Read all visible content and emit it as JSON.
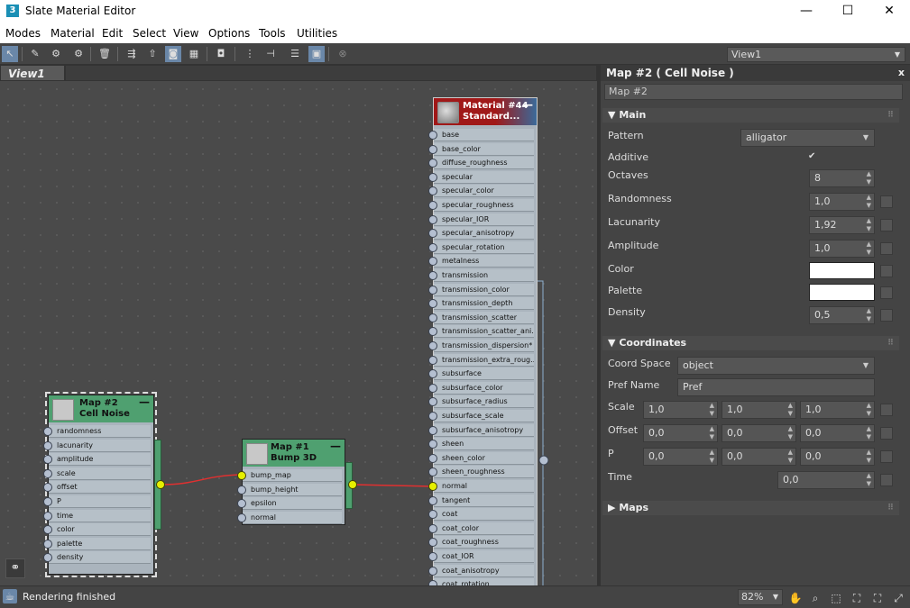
{
  "window": {
    "title": "Slate Material Editor",
    "app_icon": "3",
    "minimize": "—",
    "maximize": "☐",
    "close": "✕"
  },
  "menu": [
    "Modes",
    "Material",
    "Edit",
    "Select",
    "View",
    "Options",
    "Tools",
    "Utilities"
  ],
  "toolbar": {
    "view_select": "View1",
    "icons": [
      "select-arrow",
      "eyedropper",
      "pick-material",
      "put-to-scene",
      "delete",
      "move-children",
      "layout",
      "show-map-viewport",
      "background",
      "unique",
      "layout-all",
      "layout-children",
      "hide-unused-slots",
      "material-to-view",
      "navigator"
    ]
  },
  "view": {
    "tab_label": "View1"
  },
  "nodes": {
    "cell_noise": {
      "title_line1": "Map #2",
      "title_line2": "Cell Noise",
      "min": "—",
      "slots": [
        "randomness",
        "lacunarity",
        "amplitude",
        "scale",
        "offset",
        "P",
        "time",
        "color",
        "palette",
        "density"
      ]
    },
    "bump3d": {
      "title_line1": "Map #1",
      "title_line2": "Bump 3D",
      "min": "—",
      "slots": [
        "bump_map",
        "bump_height",
        "epsilon",
        "normal"
      ]
    },
    "material": {
      "title_line1": "Material #44",
      "title_line2": "Standard...",
      "min": "—",
      "slots": [
        "base",
        "base_color",
        "diffuse_roughness",
        "specular",
        "specular_color",
        "specular_roughness",
        "specular_IOR",
        "specular_anisotropy",
        "specular_rotation",
        "metalness",
        "transmission",
        "transmission_color",
        "transmission_depth",
        "transmission_scatter",
        "transmission_scatter_ani...",
        "transmission_dispersion*",
        "transmission_extra_roug...",
        "subsurface",
        "subsurface_color",
        "subsurface_radius",
        "subsurface_scale",
        "subsurface_anisotropy",
        "sheen",
        "sheen_color",
        "sheen_roughness",
        "normal",
        "tangent",
        "coat",
        "coat_color",
        "coat_roughness",
        "coat_IOR",
        "coat_anisotropy",
        "coat_rotation"
      ]
    }
  },
  "panel": {
    "title": "Map #2  ( Cell Noise )",
    "close": "x",
    "name_field": "Map #2",
    "main": {
      "header": "Main",
      "pattern_label": "Pattern",
      "pattern_value": "alligator",
      "additive_label": "Additive",
      "additive_check": "✔",
      "octaves_label": "Octaves",
      "octaves_value": "8",
      "randomness_label": "Randomness",
      "randomness_value": "1,0",
      "lacunarity_label": "Lacunarity",
      "lacunarity_value": "1,92",
      "amplitude_label": "Amplitude",
      "amplitude_value": "1,0",
      "color_label": "Color",
      "color_value": "#ffffff",
      "palette_label": "Palette",
      "palette_value": "#ffffff",
      "density_label": "Density",
      "density_value": "0,5"
    },
    "coordinates": {
      "header": "Coordinates",
      "coord_space_label": "Coord Space",
      "coord_space_value": "object",
      "pref_name_label": "Pref Name",
      "pref_name_value": "Pref",
      "scale_label": "Scale",
      "scale": [
        "1,0",
        "1,0",
        "1,0"
      ],
      "offset_label": "Offset",
      "offset": [
        "0,0",
        "0,0",
        "0,0"
      ],
      "p_label": "P",
      "p": [
        "0,0",
        "0,0",
        "0,0"
      ],
      "time_label": "Time",
      "time_value": "0,0"
    },
    "maps": {
      "header": "Maps"
    }
  },
  "status": {
    "text": "Rendering finished",
    "zoom": "82%"
  },
  "colors": {
    "node_green": "#4fa070",
    "material_red": "#a01818",
    "wire": "#e03030",
    "port_active": "#e6f000"
  }
}
